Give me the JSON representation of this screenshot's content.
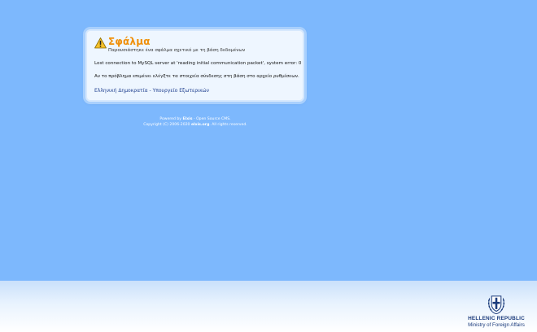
{
  "error": {
    "title": "Σφάλμα",
    "subtitle": "Παρουσιάστηκε ένα σφάλμα σχετικό με τη βάση δεδομένων",
    "detail": "Lost connection to MySQL server at 'reading initial communication packet', system error: 0",
    "hint": "Αν το πρόβλημα επιμένει ελέγξτε τα στοιχεία σύνδεσης στη βάση στο αρχείο ρυθμίσεων.",
    "org_link": "Ελληνική Δημοκρατία - Υπουργείο Εξωτερικών",
    "icon": "warning-icon"
  },
  "credits": {
    "powered_prefix": "Powered by",
    "product": "Elxis",
    "powered_suffix": "- Open Source CMS.",
    "copyright_prefix": "Copyright (C) 2006-2020",
    "site": "elxis.org",
    "copyright_suffix": ". All rights reserved."
  },
  "ministry": {
    "line1": "HELLENIC REPUBLIC",
    "line2": "Ministry of Foreign Affairs",
    "emblem": "greek-coat-of-arms-icon"
  },
  "colors": {
    "background": "#7db8fd",
    "title": "#f0900a",
    "link": "#1f3f8f",
    "ministry_text": "#1c3c7c"
  }
}
